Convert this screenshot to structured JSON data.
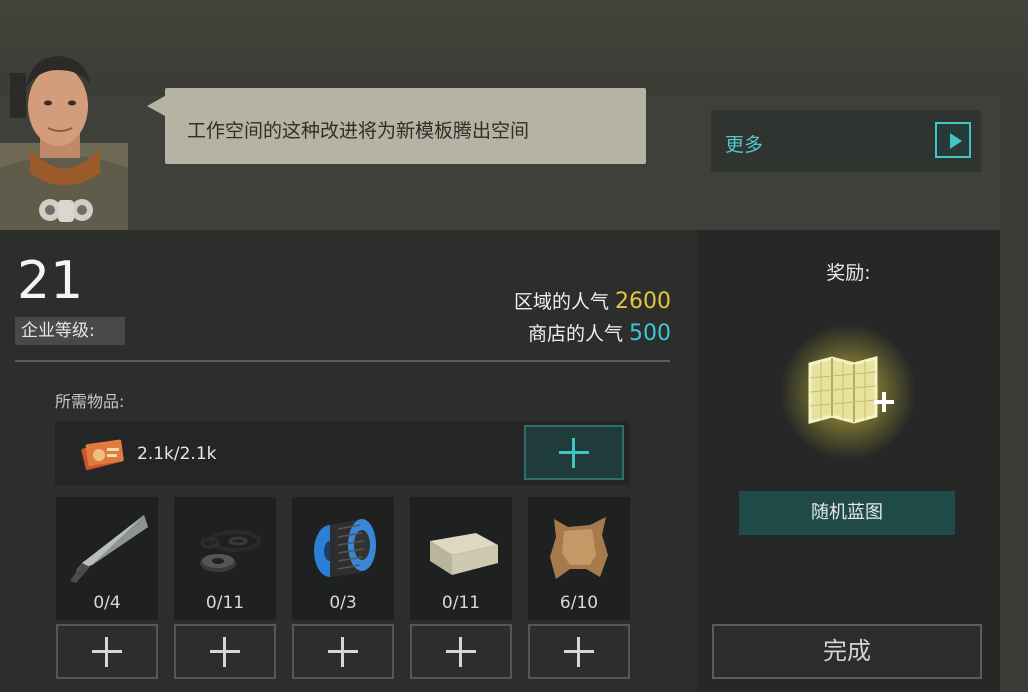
{
  "dialog": {
    "text": "工作空间的这种改进将为新模板腾出空间",
    "more_label": "更多"
  },
  "company": {
    "level": "21",
    "level_label": "企业等级:"
  },
  "popularity": {
    "area_label": "区域的人气",
    "area_value": "2600",
    "shop_label": "商店的人气",
    "shop_value": "500"
  },
  "requirements": {
    "label": "所需物品:",
    "money": "2.1k/2.1k",
    "items": [
      {
        "icon": "knife-blade-icon",
        "count": "0/4"
      },
      {
        "icon": "washers-rings-icon",
        "count": "0/11"
      },
      {
        "icon": "wire-spool-icon",
        "count": "0/3"
      },
      {
        "icon": "bar-of-soap-icon",
        "count": "0/11"
      },
      {
        "icon": "leather-hide-icon",
        "count": "6/10"
      }
    ]
  },
  "reward": {
    "title": "奖励:",
    "name": "随机蓝图",
    "icon": "blueprint-plus-icon"
  },
  "done_label": "完成",
  "colors": {
    "accent_teal": "#40c4c4",
    "gold": "#e6c540",
    "popularity_teal": "#42c5d8"
  }
}
